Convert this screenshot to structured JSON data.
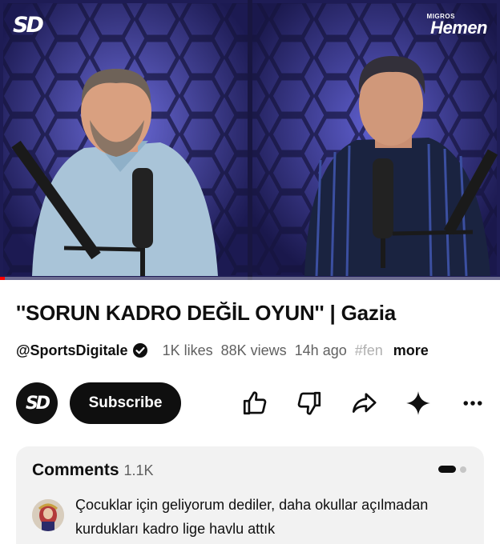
{
  "video": {
    "channel_logo": "SD",
    "sponsor_small": "MIGROS",
    "sponsor_big": "Hemen",
    "progress_fraction": 0.01
  },
  "title": "''SORUN KADRO DEĞİL OYUN'' | Gazia",
  "meta": {
    "channel": "@SportsDigitale",
    "likes": "1K likes",
    "views": "88K views",
    "age": "14h ago",
    "tag": "#fen",
    "more": "more"
  },
  "actions": {
    "avatar_text": "SD",
    "subscribe_label": "Subscribe",
    "icons": [
      "like-icon",
      "dislike-icon",
      "share-icon",
      "sparkle-icon",
      "more-icon"
    ]
  },
  "comments": {
    "label": "Comments",
    "count": "1.1K",
    "top_comment": "Çocuklar için geliyorum dediler, daha okullar açılmadan kurdukları kadro lige havlu attık"
  },
  "colors": {
    "video_bg": "#1e1c55",
    "progress": "#ff0000",
    "button": "#0f0f0f",
    "comments_bg": "#f2f2f2"
  }
}
